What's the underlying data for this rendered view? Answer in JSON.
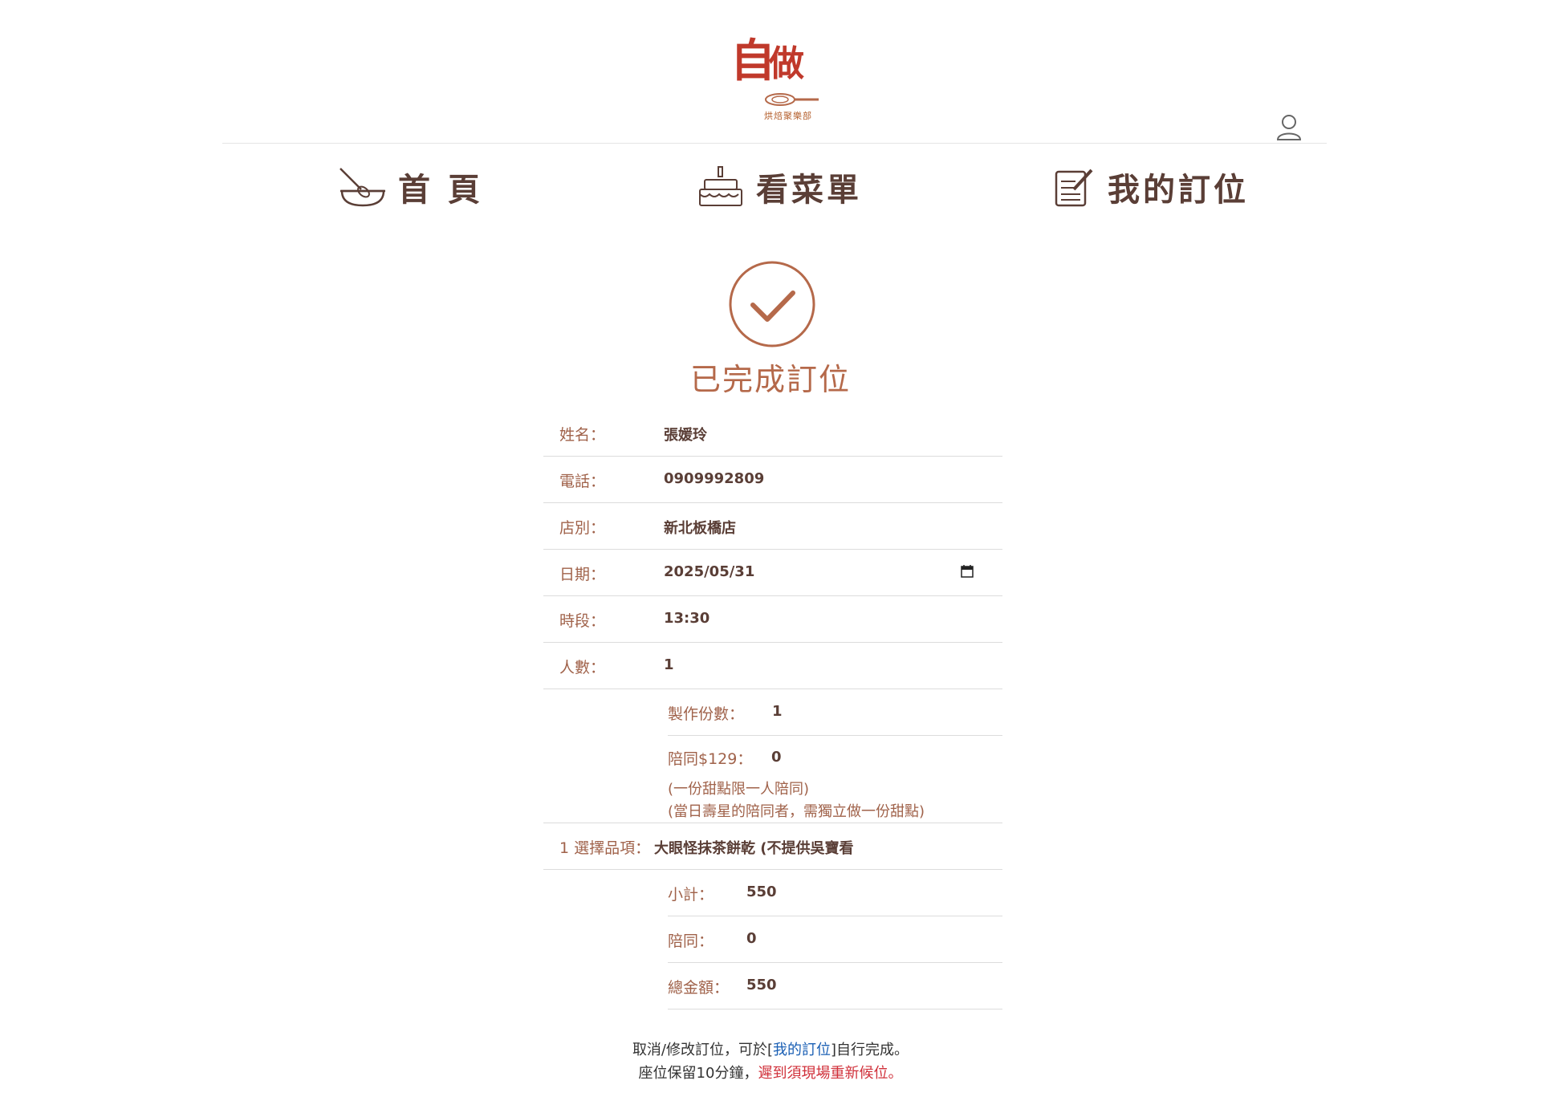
{
  "brand": {
    "logo_char1": "自",
    "logo_char2": "做",
    "logo_sub": "烘焙聚樂部"
  },
  "nav": [
    {
      "label": "首 頁",
      "icon": "mixing-bowl-icon"
    },
    {
      "label": "看菜單",
      "icon": "cake-icon"
    },
    {
      "label": "我的訂位",
      "icon": "notepad-icon"
    }
  ],
  "success": {
    "title": "已完成訂位",
    "icon": "check-circle-icon"
  },
  "form": {
    "name_label": "姓名：",
    "name": "張媛玲",
    "phone_label": "電話：",
    "phone": "0909992809",
    "store_label": "店別：",
    "store": "新北板橋店",
    "date_label": "日期：",
    "date": "2025/05/31",
    "time_label": "時段：",
    "time": "13:30",
    "people_label": "人數：",
    "people": "1",
    "portions_label": "製作份數：",
    "portions": "1",
    "accomp_label": "陪同$129：",
    "accomp": "0",
    "accomp_note1": "(一份甜點限一人陪同)",
    "accomp_note2": "(當日壽星的陪同者，需獨立做一份甜點)",
    "item_label": "1 選擇品項：",
    "item": "大眼怪抹茶餅乾 (不提供吳寶看",
    "subtotal_label": "小計：",
    "subtotal": "550",
    "accomp_fee_label": "陪同：",
    "accomp_fee": "0",
    "total_label": "總金額：",
    "total": "550"
  },
  "footer": {
    "line1_pre": "取消/修改訂位，可於[",
    "line1_link": "我的訂位",
    "line1_post": "]自行完成。",
    "line2_pre": "座位保留10分鐘，",
    "line2_warn": "遲到須現場重新候位。"
  },
  "colors": {
    "accent": "#b5694a",
    "brand_red": "#c0392b",
    "text": "#5a3e36",
    "link": "#1a5fb4",
    "warn": "#d0303a"
  }
}
